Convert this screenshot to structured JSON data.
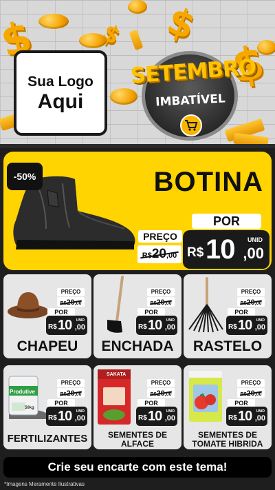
{
  "colors": {
    "accent": "#ffd400",
    "dark": "#1a1a1a",
    "card": "#e6e6e6"
  },
  "header": {
    "logo_line1": "Sua Logo",
    "logo_line2": "Aqui",
    "campaign_title": "SETEMBRO",
    "campaign_subtitle": "IMBATÍVEL",
    "icons": [
      "cart-icon"
    ]
  },
  "hero": {
    "discount": "-50%",
    "title": "BOTINA",
    "preco_label": "PREÇO",
    "old_price": {
      "currency": "R$",
      "int": "20",
      "dec": ",00"
    },
    "por_label": "POR",
    "price": {
      "currency": "R$",
      "int": "10",
      "dec": ",00",
      "unit": "UNID"
    }
  },
  "products": [
    {
      "title": "CHAPEU",
      "preco_label": "PREÇO",
      "old_price": {
        "currency": "R$",
        "int": "20",
        "dec": ",00"
      },
      "por_label": "POR",
      "price": {
        "currency": "R$",
        "int": "10",
        "dec": ",00",
        "unit": "UNID"
      }
    },
    {
      "title": "ENCHADA",
      "preco_label": "PREÇO",
      "old_price": {
        "currency": "R$",
        "int": "20",
        "dec": ",00"
      },
      "por_label": "POR",
      "price": {
        "currency": "R$",
        "int": "10",
        "dec": ",00",
        "unit": "UNID"
      }
    },
    {
      "title": "RASTELO",
      "preco_label": "PREÇO",
      "old_price": {
        "currency": "R$",
        "int": "20",
        "dec": ",00"
      },
      "por_label": "POR",
      "price": {
        "currency": "R$",
        "int": "10",
        "dec": ",00",
        "unit": "UNID"
      }
    },
    {
      "title": "FERTILIZANTES",
      "preco_label": "PREÇO",
      "old_price": {
        "currency": "R$",
        "int": "20",
        "dec": ",00"
      },
      "por_label": "POR",
      "price": {
        "currency": "R$",
        "int": "10",
        "dec": ",00",
        "unit": "UNID"
      },
      "package_label": "Produtive",
      "package_weight": "50kg"
    },
    {
      "title_line1": "SEMENTES DE",
      "title_line2": "ALFACE",
      "preco_label": "PREÇO",
      "old_price": {
        "currency": "R$",
        "int": "20",
        "dec": ",00"
      },
      "por_label": "POR",
      "price": {
        "currency": "R$",
        "int": "10",
        "dec": ",00",
        "unit": "UNID"
      },
      "package_label": "SAKATA"
    },
    {
      "title_line1": "SEMENTES DE",
      "title_line2": "TOMATE HIBRIDA",
      "preco_label": "PREÇO",
      "old_price": {
        "currency": "R$",
        "int": "20",
        "dec": ",00"
      },
      "por_label": "POR",
      "price": {
        "currency": "R$",
        "int": "10",
        "dec": ",00",
        "unit": "UNID"
      }
    }
  ],
  "footer": {
    "cta": "Crie seu encarte com este tema!",
    "note": "*Imagens Meramente Ilustrativas"
  }
}
